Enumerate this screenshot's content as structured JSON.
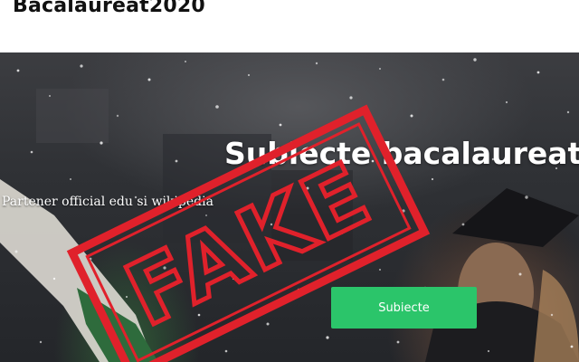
{
  "header": {
    "site_title": "Bacalaureat2020"
  },
  "hero": {
    "heading": "Subiecte bacalaureat",
    "subtitle": "Partener official edu si wikipedia",
    "cta_label": "Subiecte"
  },
  "overlay": {
    "stamp_text": "FAKE"
  },
  "colors": {
    "cta_background": "#2bc56a",
    "stamp_red": "#e0212b",
    "hero_dark": "#2f3135"
  },
  "icons": [
    "snow-particles",
    "fake-stamp"
  ]
}
